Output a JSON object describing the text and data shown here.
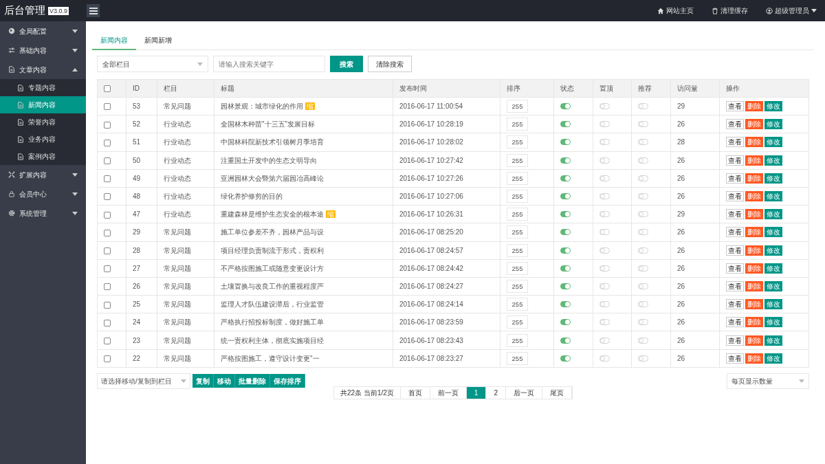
{
  "logo": {
    "title": "后台管理",
    "version": "V3.0.9"
  },
  "topbar": {
    "links": [
      {
        "label": "网站主页",
        "dropdown": false
      },
      {
        "label": "清理缓存",
        "dropdown": false
      },
      {
        "label": "超级管理员",
        "dropdown": true
      }
    ]
  },
  "sidebar": {
    "items": [
      {
        "label": "全局配置",
        "expanded": false
      },
      {
        "label": "基础内容",
        "expanded": false
      },
      {
        "label": "文章内容",
        "expanded": true,
        "children": [
          {
            "label": "专题内容",
            "selected": false
          },
          {
            "label": "新闻内容",
            "selected": true
          },
          {
            "label": "荣誉内容",
            "selected": false
          },
          {
            "label": "业务内容",
            "selected": false
          },
          {
            "label": "案例内容",
            "selected": false
          }
        ]
      },
      {
        "label": "扩展内容",
        "expanded": false
      },
      {
        "label": "会员中心",
        "expanded": false
      },
      {
        "label": "系统管理",
        "expanded": false
      }
    ]
  },
  "tabs": [
    {
      "label": "新闻内容",
      "selected": true
    },
    {
      "label": "新闻新增",
      "selected": false
    }
  ],
  "filters": {
    "category": "全部栏目",
    "search": {
      "placeholder": "请输入搜索关键字"
    },
    "search_button": "搜索",
    "clear_button": "清除搜索"
  },
  "table": {
    "columns": [
      "ID",
      "栏目",
      "标题",
      "发布时间",
      "排序",
      "状态",
      "置顶",
      "推荐",
      "访问量",
      "操作"
    ],
    "select_all_checked": false,
    "rows": [
      {
        "id": "53",
        "category": "常见问题",
        "title": "园林景观：城市绿化的作用",
        "badge": "缩",
        "time": "2016-06-17 11:00:54",
        "order": "255",
        "status": true,
        "top": false,
        "recommend": false,
        "visits": "29",
        "checked": false,
        "actions": [
          "查看",
          "删除",
          "修改"
        ]
      },
      {
        "id": "52",
        "category": "行业动态",
        "title": "全国林木种苗\"十三五\"发展目标",
        "time": "2016-06-17 10:28:19",
        "order": "255",
        "status": true,
        "top": false,
        "recommend": false,
        "visits": "26",
        "checked": false,
        "actions": [
          "查看",
          "删除",
          "修改"
        ]
      },
      {
        "id": "51",
        "category": "行业动态",
        "title": "中国林科院新技术引领树月季培育",
        "time": "2016-06-17 10:28:02",
        "order": "255",
        "status": true,
        "top": false,
        "recommend": false,
        "visits": "28",
        "checked": false,
        "actions": [
          "查看",
          "删除",
          "修改"
        ]
      },
      {
        "id": "50",
        "category": "行业动态",
        "title": "注重国土开发中的生态文明导向",
        "time": "2016-06-17 10:27:42",
        "order": "255",
        "status": true,
        "top": false,
        "recommend": false,
        "visits": "26",
        "checked": false,
        "actions": [
          "查看",
          "删除",
          "修改"
        ]
      },
      {
        "id": "49",
        "category": "行业动态",
        "title": "亚洲园林大会暨第六届园冶高峰论",
        "time": "2016-06-17 10:27:26",
        "order": "255",
        "status": true,
        "top": false,
        "recommend": false,
        "visits": "26",
        "checked": false,
        "actions": [
          "查看",
          "删除",
          "修改"
        ]
      },
      {
        "id": "48",
        "category": "行业动态",
        "title": "绿化养护修剪的目的",
        "time": "2016-06-17 10:27:06",
        "order": "255",
        "status": true,
        "top": false,
        "recommend": false,
        "visits": "26",
        "checked": false,
        "actions": [
          "查看",
          "删除",
          "修改"
        ]
      },
      {
        "id": "47",
        "category": "行业动态",
        "title": "重建森林是维护生态安全的根本途",
        "badge": "缩",
        "time": "2016-06-17 10:26:31",
        "order": "255",
        "status": true,
        "top": false,
        "recommend": false,
        "visits": "29",
        "checked": false,
        "actions": [
          "查看",
          "删除",
          "修改"
        ]
      },
      {
        "id": "29",
        "category": "常见问题",
        "title": "施工单位参差不齐，园林产品与设",
        "time": "2016-06-17 08:25:20",
        "order": "255",
        "status": true,
        "top": false,
        "recommend": false,
        "visits": "26",
        "checked": false,
        "actions": [
          "查看",
          "删除",
          "修改"
        ]
      },
      {
        "id": "28",
        "category": "常见问题",
        "title": "项目经理负责制流于形式，责权利",
        "time": "2016-06-17 08:24:57",
        "order": "255",
        "status": true,
        "top": false,
        "recommend": false,
        "visits": "26",
        "checked": false,
        "actions": [
          "查看",
          "删除",
          "修改"
        ]
      },
      {
        "id": "27",
        "category": "常见问题",
        "title": "不严格按图施工或随意变更设计方",
        "time": "2016-06-17 08:24:42",
        "order": "255",
        "status": true,
        "top": false,
        "recommend": false,
        "visits": "26",
        "checked": false,
        "actions": [
          "查看",
          "删除",
          "修改"
        ]
      },
      {
        "id": "26",
        "category": "常见问题",
        "title": "土壤置换与改良工作的重视程度严",
        "time": "2016-06-17 08:24:27",
        "order": "255",
        "status": true,
        "top": false,
        "recommend": false,
        "visits": "26",
        "checked": false,
        "actions": [
          "查看",
          "删除",
          "修改"
        ]
      },
      {
        "id": "25",
        "category": "常见问题",
        "title": "监理人才队伍建设滞后，行业监管",
        "time": "2016-06-17 08:24:14",
        "order": "255",
        "status": true,
        "top": false,
        "recommend": false,
        "visits": "26",
        "checked": false,
        "actions": [
          "查看",
          "删除",
          "修改"
        ]
      },
      {
        "id": "24",
        "category": "常见问题",
        "title": "严格执行招投标制度，做好施工单",
        "time": "2016-06-17 08:23:59",
        "order": "255",
        "status": true,
        "top": false,
        "recommend": false,
        "visits": "26",
        "checked": false,
        "actions": [
          "查看",
          "删除",
          "修改"
        ]
      },
      {
        "id": "23",
        "category": "常见问题",
        "title": "统一责权利主体，彻底实施项目经",
        "time": "2016-06-17 08:23:43",
        "order": "255",
        "status": true,
        "top": false,
        "recommend": false,
        "visits": "26",
        "checked": false,
        "actions": [
          "查看",
          "删除",
          "修改"
        ]
      },
      {
        "id": "22",
        "category": "常见问题",
        "title": "严格按图施工，遵守设计变更\"一",
        "time": "2016-06-17 08:23:27",
        "order": "255",
        "status": true,
        "top": false,
        "recommend": false,
        "visits": "26",
        "checked": false,
        "actions": [
          "查看",
          "删除",
          "修改"
        ]
      }
    ]
  },
  "bulk": {
    "target": "请选择移动/复制到栏目",
    "buttons": [
      "复制",
      "移动",
      "批量删除",
      "保存排序"
    ]
  },
  "page_size": "每页显示数量",
  "pagination": {
    "summary": "共22条 当前1/2页",
    "items": [
      {
        "label": "首页",
        "selected": false
      },
      {
        "label": "前一页",
        "selected": false
      },
      {
        "label": "1",
        "selected": true
      },
      {
        "label": "2",
        "selected": false
      },
      {
        "label": "后一页",
        "selected": false
      },
      {
        "label": "尾页",
        "selected": false
      }
    ]
  }
}
